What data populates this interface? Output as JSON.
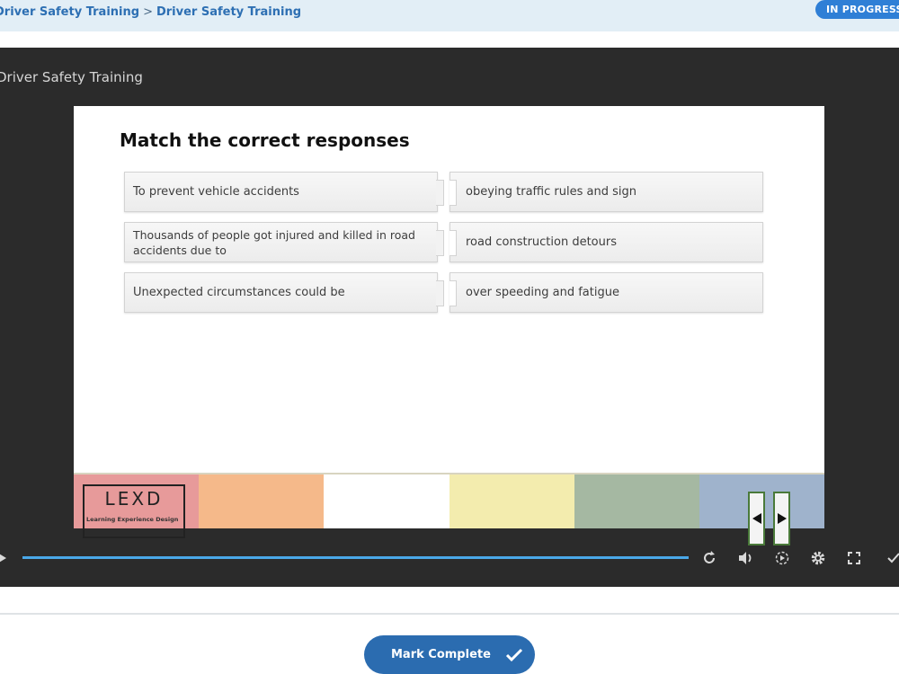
{
  "breadcrumb": {
    "course": "Driver Safety Training",
    "separator": ">",
    "lesson": "Driver Safety Training"
  },
  "status": {
    "label": "IN PROGRESS"
  },
  "player": {
    "title": "Driver Safety Training",
    "slide": {
      "heading": "Match the correct responses",
      "left_items": [
        "To prevent vehicle accidents",
        "Thousands of people got injured and killed in road accidents due to",
        "Unexpected circumstances could be"
      ],
      "right_items": [
        "obeying traffic rules and sign",
        "road construction detours",
        "over speeding and fatigue"
      ],
      "footer_colors": [
        "#e79a9a",
        "#f5b98a",
        "#ffffff",
        "#f3ecae",
        "#a5b8a2",
        "#9fb3cc"
      ],
      "logo": {
        "text": "LEXD",
        "subtitle": "Learning Experience Design"
      }
    },
    "progress": 1.0,
    "icons": [
      "play-icon",
      "replay-icon",
      "volume-icon",
      "playback-speed-icon",
      "settings-gear-icon",
      "fullscreen-icon",
      "check-icon"
    ]
  },
  "footer": {
    "mark_complete_label": "Mark Complete"
  },
  "colors": {
    "accent": "#2b6cb0",
    "badge": "#2f7fd6",
    "progress": "#4aa8e8"
  }
}
